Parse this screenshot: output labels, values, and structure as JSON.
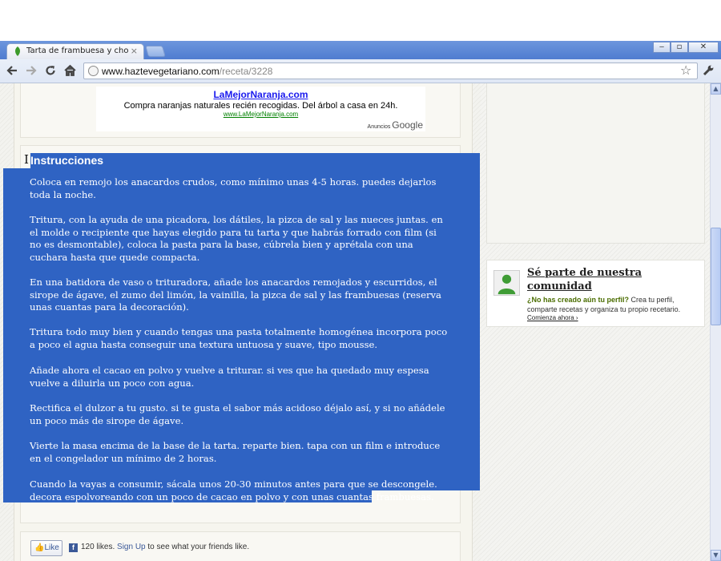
{
  "browser": {
    "tab_title": "Tarta de frambuesa y chocolat",
    "tab_close": "×",
    "window_buttons": {
      "minimize": "‒",
      "maximize": "▫",
      "close": "✕"
    },
    "url_host": "www.haztevegetariano.com",
    "url_path": "/receta/3228",
    "icons": [
      "back-icon",
      "forward-icon",
      "reload-icon",
      "home-icon",
      "globe-icon",
      "bookmark-star-icon",
      "wrench-icon"
    ]
  },
  "ad": {
    "title": "LaMejorNaranja.com",
    "line": "Compra naranjas naturales recién recogidas. Del árbol a casa en 24h.",
    "link": "www.LaMejorNaranja.com",
    "attribution_prefix": "Anuncios",
    "attribution_brand": "Google"
  },
  "instructions": {
    "heading": "Instrucciones",
    "paragraphs": [
      "Coloca en remojo los anacardos crudos, como mínimo unas 4-5 horas. puedes dejarlos toda la noche.",
      "Tritura, con la ayuda de una picadora, los dátiles, la pizca de sal y las nueces juntas. en el molde o recipiente que hayas elegido para tu tarta y que habrás forrado con film (si no es desmontable), coloca la pasta para la base, cúbrela bien y aprétala con una cuchara hasta que quede compacta.",
      "En una batidora de vaso o trituradora, añade los anacardos remojados y escurridos, el sirope de ágave, el zumo del limón, la vainilla, la pizca de sal y las frambuesas (reserva unas cuantas para la decoración).",
      "Tritura todo muy bien y cuando tengas una pasta totalmente homogénea incorpora poco a poco el agua hasta conseguir una textura untuosa y suave, tipo mousse.",
      "Añade ahora el cacao en polvo y vuelve a triturar. si ves que ha quedado muy espesa vuelve a diluirla un poco con agua.",
      "Rectifica el dulzor a tu gusto. si te gusta el sabor más acidoso déjalo así, y si no añádele un poco más de sirope de ágave.",
      "Vierte la masa encima de la base de la tarta. reparte bien. tapa con un film e introduce en el congelador un mínimo de 2 horas.",
      "Cuando la vayas a consumir, sácala unos 20-30 minutos antes para que se descongele. decora espolvoreando con un poco de cacao en polvo y con unas cuantas frambuesas."
    ]
  },
  "like_bar": {
    "button_label": "Like",
    "count_text": "120 likes.",
    "signup_link": "Sign Up",
    "suffix_text": "to see what your friends like."
  },
  "community": {
    "title": "Sé parte de nuestra comunidad",
    "question": "¿No has creado aún tu perfil?",
    "text": "Crea tu perfil, comparte recetas y organiza tu propio recetario.",
    "link": "Comienza ahora ›"
  },
  "colors": {
    "selection": "#2f63c3",
    "titlebar": "#5a86d6",
    "ad_link": "#1a1aee",
    "community_accent": "#4a6d00"
  }
}
